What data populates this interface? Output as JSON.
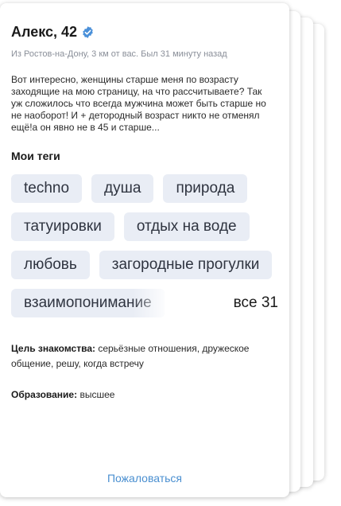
{
  "profile": {
    "name_age": "Алекс, 42",
    "meta": "Из Ростов-на-Дону, 3 км от вас. Был 31 минуту назад",
    "about": "Вот интересно, женщины старше меня по возрасту заходящие на мою страницу, на что рассчитываете? Так уж сложилось что всегда мужчина может быть старше но не наоборот! И + детородный возраст никто не отменял ещё!а он явно не в 45 и старше..."
  },
  "tags_section": {
    "title": "Мои теги",
    "tags": [
      "techno",
      "душа",
      "природа",
      "татуировки",
      "отдых на воде",
      "любовь",
      "загородные прогулки",
      "взаимопонимание"
    ],
    "all_label": "все 31"
  },
  "goal": {
    "label": "Цель знакомства:",
    "value": "серьёзные отношения, дружеское общение, решу, когда встречу"
  },
  "education": {
    "label": "Образование:",
    "value": "высшее"
  },
  "report_label": "Пожаловаться",
  "colors": {
    "verified_badge": "#4a90d9",
    "link": "#4a8fd0",
    "tag_bg": "#e9edf5"
  }
}
